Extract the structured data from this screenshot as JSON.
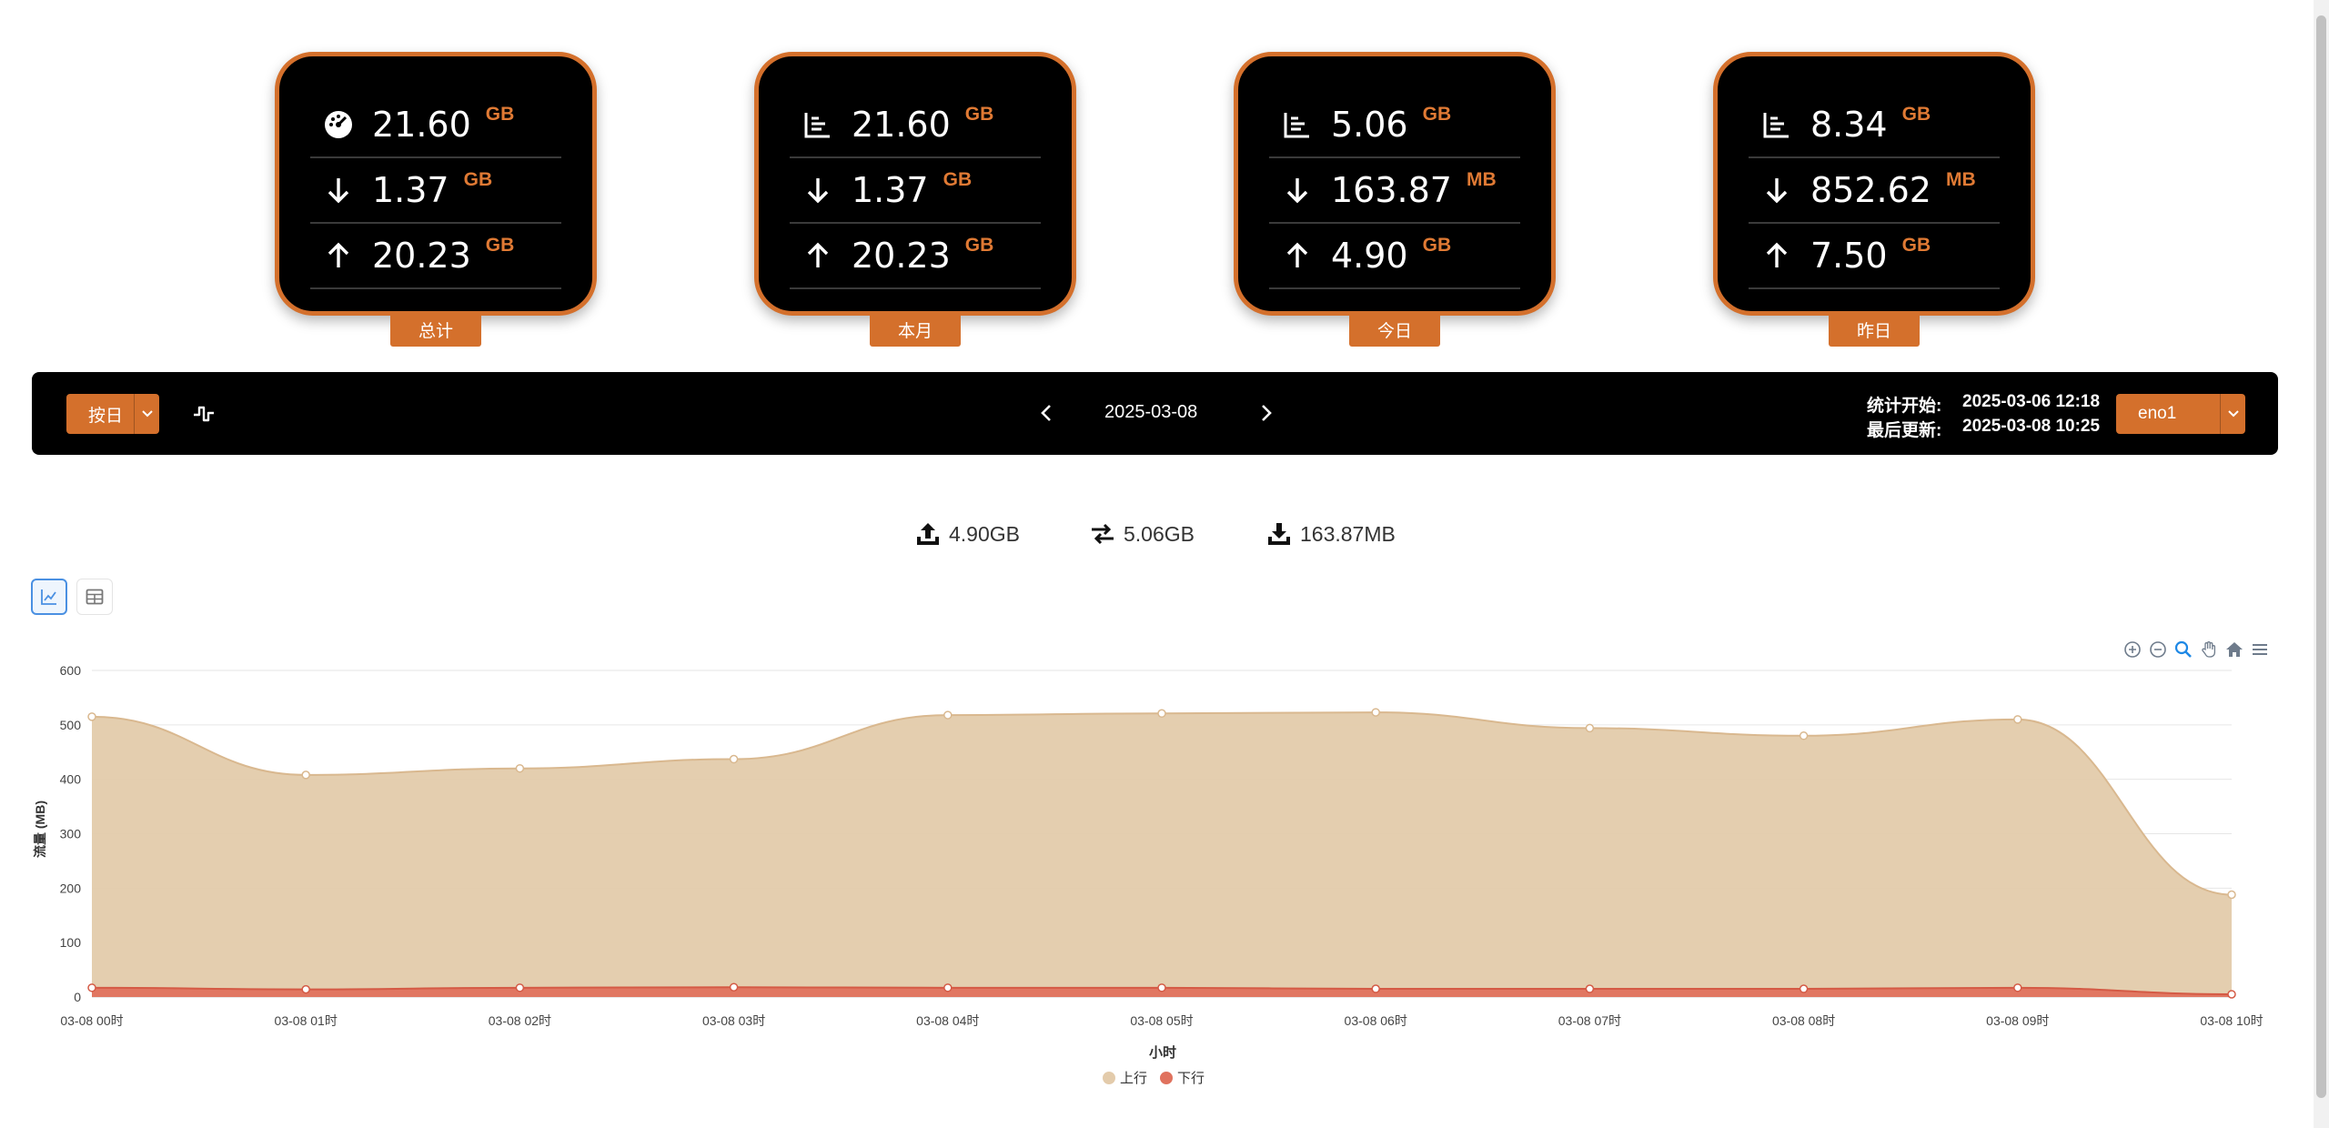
{
  "cards": [
    {
      "label": "总计",
      "total": "21.60",
      "total_unit": "GB",
      "down": "1.37",
      "down_unit": "GB",
      "up": "20.23",
      "up_unit": "GB",
      "total_icon": "speedometer-icon"
    },
    {
      "label": "本月",
      "total": "21.60",
      "total_unit": "GB",
      "down": "1.37",
      "down_unit": "GB",
      "up": "20.23",
      "up_unit": "GB",
      "total_icon": "bar-chart-icon"
    },
    {
      "label": "今日",
      "total": "5.06",
      "total_unit": "GB",
      "down": "163.87",
      "down_unit": "MB",
      "up": "4.90",
      "up_unit": "GB",
      "total_icon": "bar-chart-icon"
    },
    {
      "label": "昨日",
      "total": "8.34",
      "total_unit": "GB",
      "down": "852.62",
      "down_unit": "MB",
      "up": "7.50",
      "up_unit": "GB",
      "total_icon": "bar-chart-icon"
    }
  ],
  "toolbar": {
    "mode_label": "按日",
    "date": "2025-03-08",
    "stat_start_label": "统计开始:",
    "stat_start_value": "2025-03-06 12:18",
    "last_update_label": "最后更新:",
    "last_update_value": "2025-03-08 10:25",
    "interface": "eno1"
  },
  "summary": {
    "upload": "4.90GB",
    "total": "5.06GB",
    "download": "163.87MB"
  },
  "colors": {
    "accent": "#d4702c",
    "upstream": "#e3cbab",
    "downstream": "#e0725e"
  },
  "chart_data": {
    "type": "area",
    "xlabel": "小时",
    "ylabel": "流量 (MB)",
    "ylim": [
      0,
      600
    ],
    "yticks": [
      "0",
      "100",
      "200",
      "300",
      "400",
      "500",
      "600"
    ],
    "categories": [
      "03-08 00时",
      "03-08 01时",
      "03-08 02时",
      "03-08 03时",
      "03-08 04时",
      "03-08 05时",
      "03-08 06时",
      "03-08 07时",
      "03-08 08时",
      "03-08 09时",
      "03-08 10时"
    ],
    "series": [
      {
        "name": "上行",
        "values": [
          515,
          408,
          420,
          437,
          518,
          521,
          523,
          494,
          480,
          510,
          188
        ]
      },
      {
        "name": "下行",
        "values": [
          17,
          14,
          17,
          18,
          17,
          17,
          15,
          15,
          15,
          17,
          5
        ]
      }
    ],
    "grid": true,
    "legend": "bottom-center"
  }
}
